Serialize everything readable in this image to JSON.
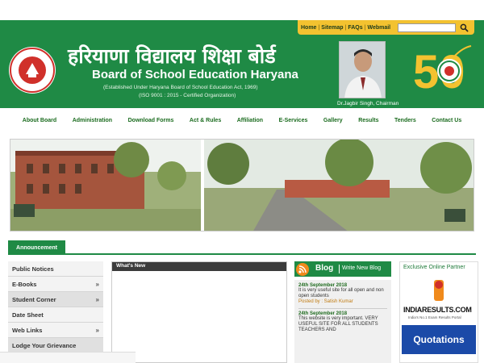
{
  "top_links": [
    "Home",
    "Sitemap",
    "FAQs",
    "Webmail"
  ],
  "search": {
    "placeholder": ""
  },
  "header": {
    "hindi_title": "हरियाणा विद्यालय शिक्षा बोर्ड",
    "english_title": "Board of School Education Haryana",
    "established": "(Established Under Haryana Board of School Education Act, 1969)",
    "iso": "(ISO 9001 : 2015 - Certified Organization)",
    "chairman": "Dr.Jagbir Singh, Chairman",
    "emblem_number": "50"
  },
  "nav": [
    "About Board",
    "Administration",
    "Download Forms",
    "Act & Rules",
    "Affiliation",
    "E-Services",
    "Gallery",
    "Results",
    "Tenders",
    "Contact Us"
  ],
  "announcement": {
    "label": "Announcement"
  },
  "side_menu": [
    {
      "label": "Public Notices",
      "arrow": ""
    },
    {
      "label": "E-Books",
      "arrow": "»"
    },
    {
      "label": "Student Corner",
      "arrow": "»"
    },
    {
      "label": "Date Sheet",
      "arrow": ""
    },
    {
      "label": "Web Links",
      "arrow": "»"
    },
    {
      "label": "Lodge Your Grievance",
      "arrow": ""
    }
  ],
  "whats_new": {
    "title": "What's New"
  },
  "blog": {
    "title": "Blog",
    "write_label": "Write New Blog",
    "posts": [
      {
        "date": "24th September 2018",
        "text": "It is very useful site for all open and non open students",
        "by": "Posted by : Satish Kumar"
      },
      {
        "date": "24th September 2018",
        "text": "This website is very important. VERY USEFUL SITE FOR ALL STUDENTS TEACHERS AND",
        "by": ""
      }
    ]
  },
  "partner": {
    "title": "Exclusive Online Partner",
    "name": "INDIARESULTS.COM",
    "tagline": "India's No.1 Exam Results Portal",
    "quotations": "Quotations"
  },
  "colors": {
    "brand_green": "#1f8a45",
    "accent_yellow": "#f3c230",
    "quotations_blue": "#1b4aa8"
  }
}
